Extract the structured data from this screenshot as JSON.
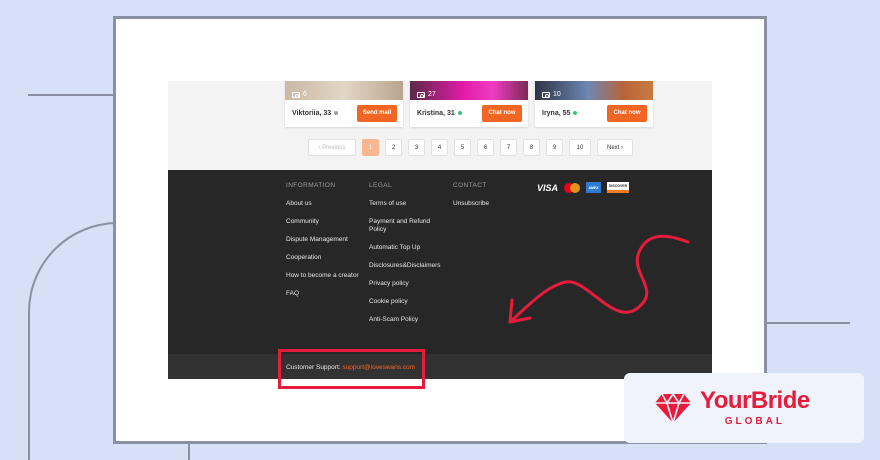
{
  "profiles": [
    {
      "photos": "6",
      "name": "Viktoriia, 33",
      "online": false,
      "action": "Send mail"
    },
    {
      "photos": "27",
      "name": "Kristina, 31",
      "online": true,
      "action": "Chat now"
    },
    {
      "photos": "10",
      "name": "Iryna, 55",
      "online": true,
      "action": "Chat now"
    }
  ],
  "pagination": {
    "prev": "Previous",
    "pages": [
      "1",
      "2",
      "3",
      "4",
      "5",
      "6",
      "7",
      "8",
      "9",
      "10"
    ],
    "active": "1",
    "next": "Next"
  },
  "footer": {
    "information": {
      "heading": "INFORMATION",
      "links": [
        "About us",
        "Community",
        "Dispute Management",
        "Cooperation",
        "How to become a creator",
        "FAQ"
      ]
    },
    "legal": {
      "heading": "LEGAL",
      "links": [
        "Terms of use",
        "Payment and Refund Policy",
        "Automatic Top Up",
        "Disclosures&Disclaimers",
        "Privacy policy",
        "Cookie policy",
        "Anti-Scam Policy"
      ]
    },
    "contact": {
      "heading": "CONTACT",
      "links": [
        "Unsubscribe"
      ]
    },
    "payment": {
      "visa": "VISA",
      "amex": "AMEX",
      "discover": "DISCOVER"
    },
    "support_label": "Customer Support:",
    "support_email": "support@loveswans.com"
  },
  "brand": {
    "name": "YourBride",
    "sub": "GLOBAL"
  },
  "colors": {
    "accent": "#f26522",
    "highlight": "#e51c3b",
    "online": "#2ecc71",
    "offline": "#9e9e9e"
  }
}
